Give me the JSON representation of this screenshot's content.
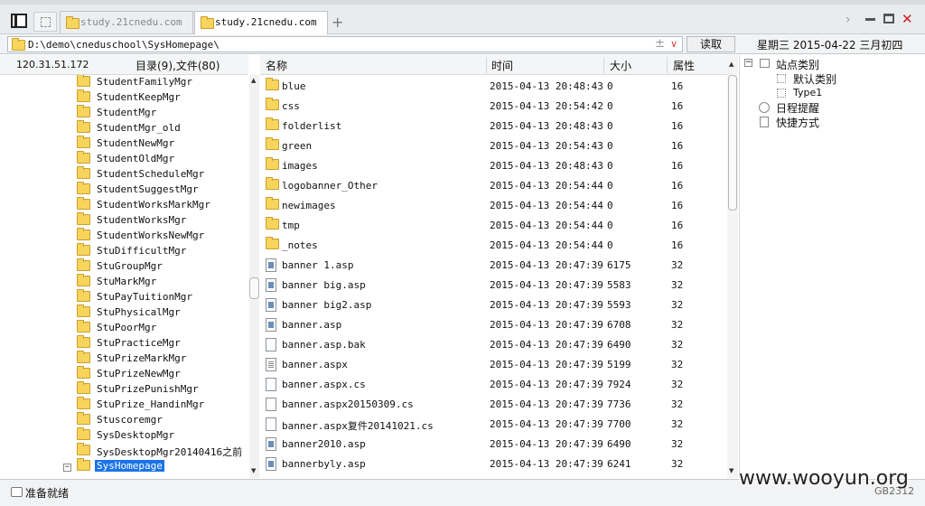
{
  "tabs": [
    {
      "label": "study.21cnedu.com",
      "active": false
    },
    {
      "label": "study.21cnedu.com",
      "active": true
    }
  ],
  "address": {
    "path": "D:\\demo\\cneduschool\\SysHomepage\\",
    "read_button": "读取"
  },
  "calendar": {
    "text": "星期三 2015-04-22 三月初四"
  },
  "left_pane": {
    "ip": "120.31.51.172",
    "dir_count": "目录(9),文件(80)",
    "tree_items": [
      "StudentFamilyMgr",
      "StudentKeepMgr",
      "StudentMgr",
      "StudentMgr_old",
      "StudentNewMgr",
      "StudentOldMgr",
      "StudentScheduleMgr",
      "StudentSuggestMgr",
      "StudentWorksMarkMgr",
      "StudentWorksMgr",
      "StudentWorksNewMgr",
      "StuDifficultMgr",
      "StuGroupMgr",
      "StuMarkMgr",
      "StuPayTuitionMgr",
      "StuPhysicalMgr",
      "StuPoorMgr",
      "StuPracticeMgr",
      "StuPrizeMarkMgr",
      "StuPrizeNewMgr",
      "StuPrizePunishMgr",
      "StuPrize_HandinMgr",
      "Stuscoremgr",
      "SysDesktopMgr",
      "SysDesktopMgr20140416之前",
      "SysHomepage"
    ],
    "selected": "SysHomepage"
  },
  "file_list": {
    "headers": {
      "name": "名称",
      "time": "时间",
      "size": "大小",
      "attr": "属性"
    },
    "rows": [
      {
        "name": "blue",
        "time": "2015-04-13 20:48:43",
        "size": "0",
        "attr": "16",
        "type": "folder"
      },
      {
        "name": "css",
        "time": "2015-04-13 20:54:42",
        "size": "0",
        "attr": "16",
        "type": "folder"
      },
      {
        "name": "folderlist",
        "time": "2015-04-13 20:48:43",
        "size": "0",
        "attr": "16",
        "type": "folder"
      },
      {
        "name": "green",
        "time": "2015-04-13 20:54:43",
        "size": "0",
        "attr": "16",
        "type": "folder"
      },
      {
        "name": "images",
        "time": "2015-04-13 20:48:43",
        "size": "0",
        "attr": "16",
        "type": "folder"
      },
      {
        "name": "logobanner_Other",
        "time": "2015-04-13 20:54:44",
        "size": "0",
        "attr": "16",
        "type": "folder"
      },
      {
        "name": "newimages",
        "time": "2015-04-13 20:54:44",
        "size": "0",
        "attr": "16",
        "type": "folder"
      },
      {
        "name": "tmp",
        "time": "2015-04-13 20:54:44",
        "size": "0",
        "attr": "16",
        "type": "folder"
      },
      {
        "name": "_notes",
        "time": "2015-04-13 20:54:44",
        "size": "0",
        "attr": "16",
        "type": "folder"
      },
      {
        "name": "banner 1.asp",
        "time": "2015-04-13 20:47:39",
        "size": "6175",
        "attr": "32",
        "type": "asp"
      },
      {
        "name": "banner big.asp",
        "time": "2015-04-13 20:47:39",
        "size": "5583",
        "attr": "32",
        "type": "asp"
      },
      {
        "name": "banner big2.asp",
        "time": "2015-04-13 20:47:39",
        "size": "5593",
        "attr": "32",
        "type": "asp"
      },
      {
        "name": "banner.asp",
        "time": "2015-04-13 20:47:39",
        "size": "6708",
        "attr": "32",
        "type": "asp"
      },
      {
        "name": "banner.asp.bak",
        "time": "2015-04-13 20:47:39",
        "size": "6490",
        "attr": "32",
        "type": "blank"
      },
      {
        "name": "banner.aspx",
        "time": "2015-04-13 20:47:39",
        "size": "5199",
        "attr": "32",
        "type": "txt"
      },
      {
        "name": "banner.aspx.cs",
        "time": "2015-04-13 20:47:39",
        "size": "7924",
        "attr": "32",
        "type": "blank"
      },
      {
        "name": "banner.aspx20150309.cs",
        "time": "2015-04-13 20:47:39",
        "size": "7736",
        "attr": "32",
        "type": "blank"
      },
      {
        "name": "banner.aspx复件20141021.cs",
        "time": "2015-04-13 20:47:39",
        "size": "7700",
        "attr": "32",
        "type": "blank"
      },
      {
        "name": "banner2010.asp",
        "time": "2015-04-13 20:47:39",
        "size": "6490",
        "attr": "32",
        "type": "asp"
      },
      {
        "name": "bannerbyly.asp",
        "time": "2015-04-13 20:47:39",
        "size": "6241",
        "attr": "32",
        "type": "asp"
      }
    ]
  },
  "right_pane": {
    "root": "站点类别",
    "children": [
      "默认类别",
      "Type1"
    ],
    "schedule": "日程提醒",
    "shortcut": "快捷方式"
  },
  "status": {
    "text": "准备就绪",
    "encoding": "GB2312"
  },
  "watermark": "www.wooyun.org"
}
